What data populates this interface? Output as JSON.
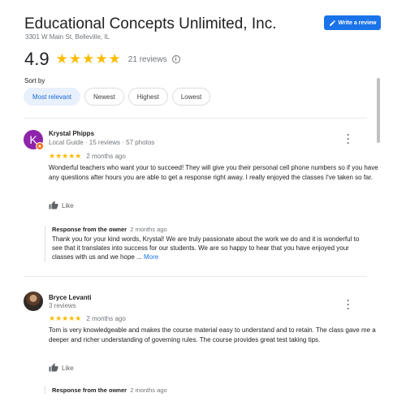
{
  "business": {
    "name": "Educational Concepts Unlimited, Inc.",
    "address": "3301 W Main St, Belleville, IL"
  },
  "write_review_label": "Write a review",
  "summary": {
    "rating": "4.9",
    "stars": "★★★★★",
    "review_count": "21 reviews",
    "info_icon": "i"
  },
  "sort": {
    "label": "Sort by",
    "options": [
      "Most relevant",
      "Newest",
      "Highest",
      "Lowest"
    ],
    "selected": "Most relevant"
  },
  "reviews": [
    {
      "name": "Krystal Phipps",
      "meta": "Local Guide · 15 reviews · 57 photos",
      "avatar_letter": "K",
      "avatar_color": "#8e24aa",
      "stars": "★★★★★",
      "date": "2 months ago",
      "text": "Wonderful teachers who want your to succeed! They will give you their personal cell phone numbers so if you have any questions after hours you are able to get a response right away. I really enjoyed the classes I've taken so far.",
      "like_label": "Like",
      "owner_response": {
        "title": "Response from the owner",
        "date": "2 months ago",
        "text": "Thank you for your kind words, Krystal! We are truly passionate about the work we do and it is wonderful to see that it translates into success for our students. We are so happy to hear that you have enjoyed your classes with us and we hope ...",
        "more": "More"
      }
    },
    {
      "name": "Bryce Levanti",
      "meta": "3 reviews",
      "stars": "★★★★★",
      "date": "2 months ago",
      "text": "Tom is very knowledgeable and makes the course material easy to understand and to retain.  The class gave me a deeper and richer understanding of governing rules.  The course provides great test taking tips.",
      "like_label": "Like",
      "owner_response": {
        "title": "Response from the owner",
        "date": "2 months ago"
      }
    }
  ],
  "colors": {
    "accent": "#1a73e8",
    "star": "#fbbc04",
    "chip_active_bg": "#e8f0fe"
  }
}
